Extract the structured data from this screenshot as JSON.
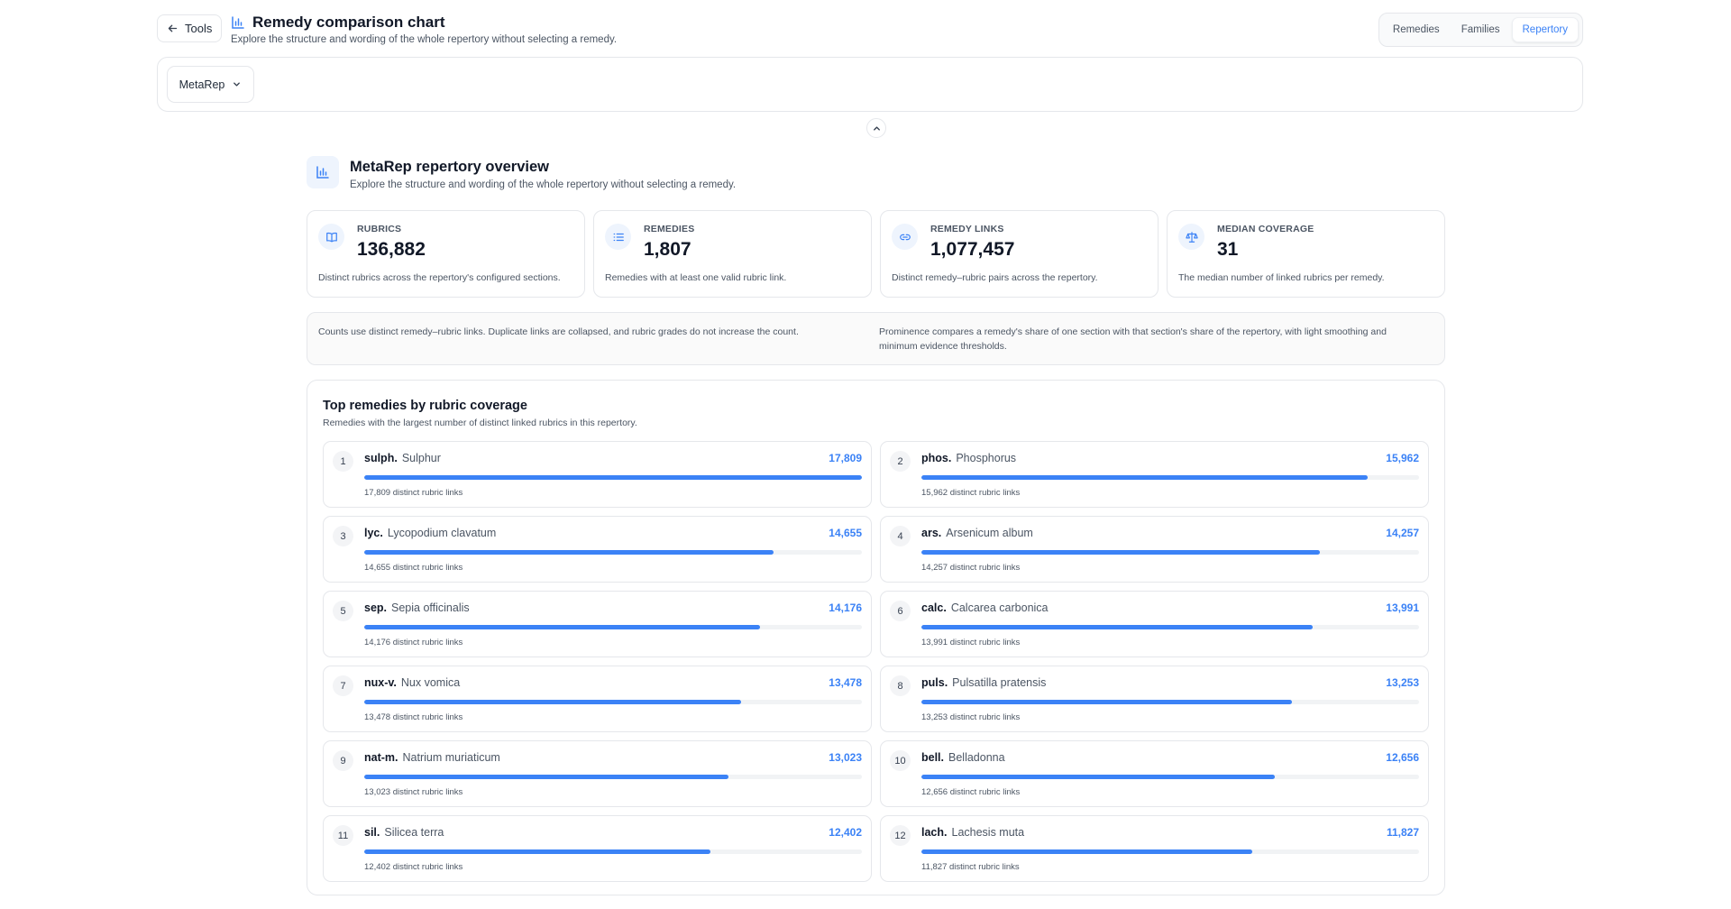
{
  "header": {
    "tools_label": "Tools",
    "title": "Remedy comparison chart",
    "subtitle": "Explore the structure and wording of the whole repertory without selecting a remedy.",
    "tabs": [
      {
        "label": "Remedies",
        "active": false
      },
      {
        "label": "Families",
        "active": false
      },
      {
        "label": "Repertory",
        "active": true
      }
    ]
  },
  "selector": {
    "value": "MetaRep"
  },
  "overview": {
    "title": "MetaRep repertory overview",
    "subtitle": "Explore the structure and wording of the whole repertory without selecting a remedy.",
    "stats": [
      {
        "icon": "book-icon",
        "label": "RUBRICS",
        "value": "136,882",
        "desc": "Distinct rubrics across the repertory's configured sections."
      },
      {
        "icon": "list-icon",
        "label": "REMEDIES",
        "value": "1,807",
        "desc": "Remedies with at least one valid rubric link."
      },
      {
        "icon": "link-icon",
        "label": "REMEDY LINKS",
        "value": "1,077,457",
        "desc": "Distinct remedy–rubric pairs across the repertory."
      },
      {
        "icon": "scale-icon",
        "label": "MEDIAN COVERAGE",
        "value": "31",
        "desc": "The median number of linked rubrics per remedy."
      }
    ],
    "notes": [
      "Counts use distinct remedy–rubric links. Duplicate links are collapsed, and rubric grades do not increase the count.",
      "Prominence compares a remedy's share of one section with that section's share of the repertory, with light smoothing and minimum evidence thresholds."
    ]
  },
  "top_remedies": {
    "title": "Top remedies by rubric coverage",
    "subtitle": "Remedies with the largest number of distinct linked rubrics in this repertory.",
    "max": 17809,
    "accent": "#3b82f6",
    "items": [
      {
        "rank": "1",
        "abbr": "sulph.",
        "name": "Sulphur",
        "count": "17,809",
        "value": 17809,
        "desc": "17,809 distinct rubric links"
      },
      {
        "rank": "2",
        "abbr": "phos.",
        "name": "Phosphorus",
        "count": "15,962",
        "value": 15962,
        "desc": "15,962 distinct rubric links"
      },
      {
        "rank": "3",
        "abbr": "lyc.",
        "name": "Lycopodium clavatum",
        "count": "14,655",
        "value": 14655,
        "desc": "14,655 distinct rubric links"
      },
      {
        "rank": "4",
        "abbr": "ars.",
        "name": "Arsenicum album",
        "count": "14,257",
        "value": 14257,
        "desc": "14,257 distinct rubric links"
      },
      {
        "rank": "5",
        "abbr": "sep.",
        "name": "Sepia officinalis",
        "count": "14,176",
        "value": 14176,
        "desc": "14,176 distinct rubric links"
      },
      {
        "rank": "6",
        "abbr": "calc.",
        "name": "Calcarea carbonica",
        "count": "13,991",
        "value": 13991,
        "desc": "13,991 distinct rubric links"
      },
      {
        "rank": "7",
        "abbr": "nux-v.",
        "name": "Nux vomica",
        "count": "13,478",
        "value": 13478,
        "desc": "13,478 distinct rubric links"
      },
      {
        "rank": "8",
        "abbr": "puls.",
        "name": "Pulsatilla pratensis",
        "count": "13,253",
        "value": 13253,
        "desc": "13,253 distinct rubric links"
      },
      {
        "rank": "9",
        "abbr": "nat-m.",
        "name": "Natrium muriaticum",
        "count": "13,023",
        "value": 13023,
        "desc": "13,023 distinct rubric links"
      },
      {
        "rank": "10",
        "abbr": "bell.",
        "name": "Belladonna",
        "count": "12,656",
        "value": 12656,
        "desc": "12,656 distinct rubric links"
      },
      {
        "rank": "11",
        "abbr": "sil.",
        "name": "Silicea terra",
        "count": "12,402",
        "value": 12402,
        "desc": "12,402 distinct rubric links"
      },
      {
        "rank": "12",
        "abbr": "lach.",
        "name": "Lachesis muta",
        "count": "11,827",
        "value": 11827,
        "desc": "11,827 distinct rubric links"
      }
    ]
  }
}
